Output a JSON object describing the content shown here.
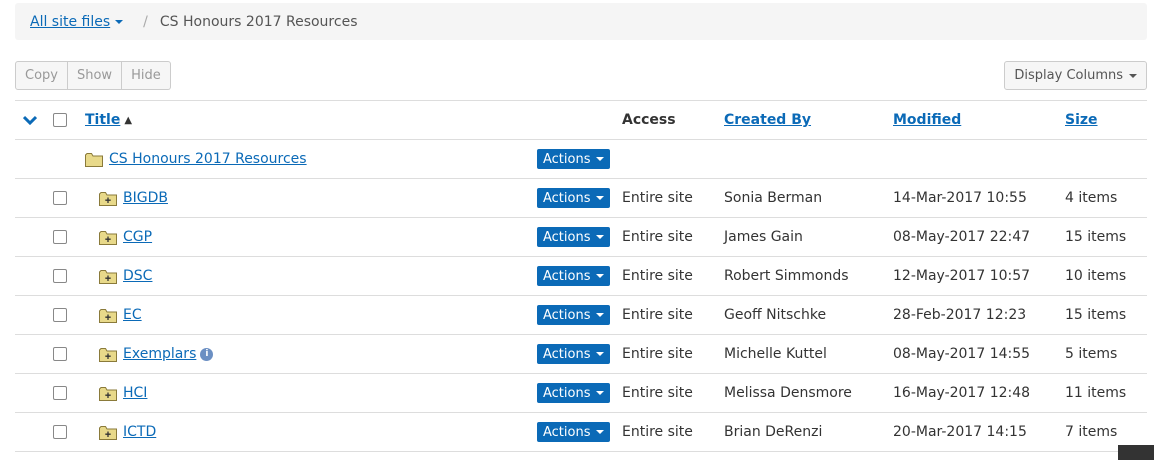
{
  "breadcrumb": {
    "root": "All site files",
    "separator": "/",
    "current": "CS Honours 2017 Resources"
  },
  "toolbar": {
    "copy": "Copy",
    "show": "Show",
    "hide": "Hide",
    "display_columns": "Display Columns"
  },
  "table": {
    "headers": {
      "title": "Title",
      "access": "Access",
      "created_by": "Created By",
      "modified": "Modified",
      "size": "Size"
    },
    "parent": {
      "title": "CS Honours 2017 Resources",
      "actions": "Actions"
    },
    "rows": [
      {
        "title": "BIGDB",
        "actions": "Actions",
        "access": "Entire site",
        "created_by": "Sonia Berman",
        "modified": "14-Mar-2017 10:55",
        "size": "4 items"
      },
      {
        "title": "CGP",
        "actions": "Actions",
        "access": "Entire site",
        "created_by": "James Gain",
        "modified": "08-May-2017 22:47",
        "size": "15 items"
      },
      {
        "title": "DSC",
        "actions": "Actions",
        "access": "Entire site",
        "created_by": "Robert Simmonds",
        "modified": "12-May-2017 10:57",
        "size": "10 items"
      },
      {
        "title": "EC",
        "actions": "Actions",
        "access": "Entire site",
        "created_by": "Geoff Nitschke",
        "modified": "28-Feb-2017 12:23",
        "size": "15 items"
      },
      {
        "title": "Exemplars",
        "actions": "Actions",
        "access": "Entire site",
        "created_by": "Michelle Kuttel",
        "modified": "08-May-2017 14:55",
        "size": "5 items"
      },
      {
        "title": "HCI",
        "actions": "Actions",
        "access": "Entire site",
        "created_by": "Melissa Densmore",
        "modified": "16-May-2017 12:48",
        "size": "11 items"
      },
      {
        "title": "ICTD",
        "actions": "Actions",
        "access": "Entire site",
        "created_by": "Brian DeRenzi",
        "modified": "20-Mar-2017 14:15",
        "size": "7 items"
      }
    ]
  },
  "icons": {
    "info": "i",
    "sort": "▲"
  },
  "colors": {
    "link": "#0b6ab7",
    "action_button": "#0b6ab7"
  }
}
